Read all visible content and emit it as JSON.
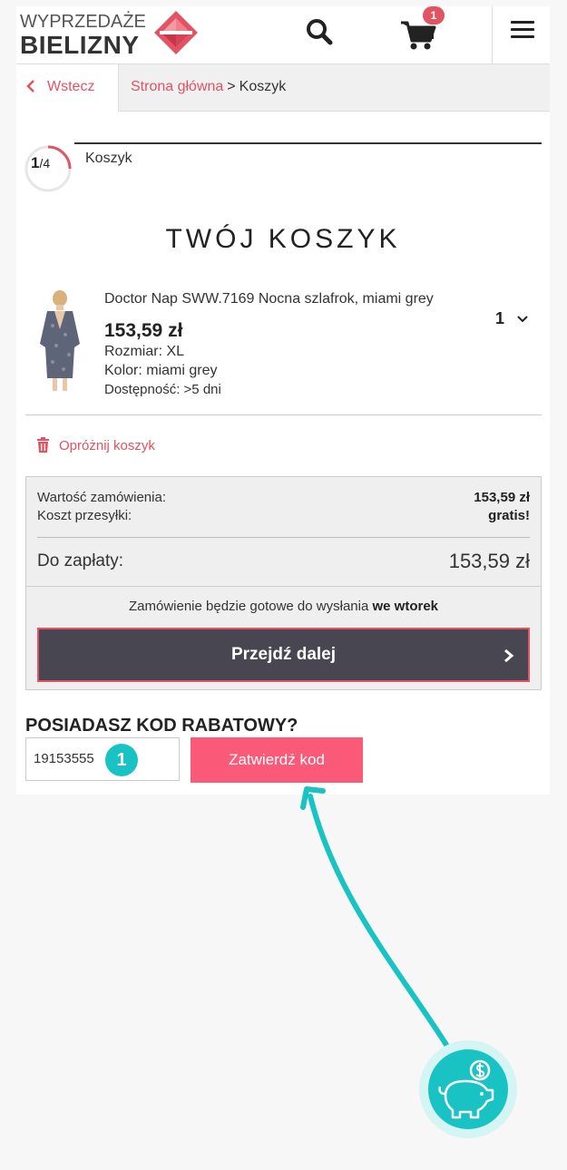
{
  "header": {
    "logo_line1": "WYPRZEDAŻE",
    "logo_line2": "BIELIZNY",
    "cart_count": "1",
    "icons": [
      "search-icon",
      "cart-icon",
      "hamburger-menu-icon"
    ]
  },
  "breadcrumb": {
    "back_label": "Wstecz",
    "home_label": "Strona główna",
    "separator": ">",
    "current_label": "Koszyk"
  },
  "steps": {
    "current": "1",
    "total": "/4",
    "label": "Koszyk"
  },
  "page_title": "TWÓJ KOSZYK",
  "product": {
    "name": "Doctor Nap SWW.7169 Nocna szlafrok, miami grey",
    "price": "153,59 zł",
    "size": "Rozmiar: XL",
    "color": "Kolor: miami grey",
    "availability": "Dostępność: >5 dni",
    "quantity": "1"
  },
  "empty_cart_label": "Opróżnij koszyk",
  "summary": {
    "order_value_label": "Wartość zamówienia:",
    "order_value": "153,59 zł",
    "shipping_label": "Koszt przesyłki:",
    "shipping_value": "gratis!",
    "to_pay_label": "Do zapłaty:",
    "to_pay_value": "153,59 zł",
    "ready_text": "Zamówienie będzie gotowe do wysłania",
    "ready_day": "we wtorek",
    "proceed_label": "Przejdź dalej"
  },
  "coupon": {
    "title": "POSIADASZ KOD RABATOWY?",
    "code_value": "19153555",
    "submit_label": "Zatwierdź kod"
  },
  "annotation": {
    "marker_label": "1"
  },
  "colors": {
    "accent": "#e25363",
    "submit_pink": "#fb5978",
    "dark_button": "#484751",
    "teal": "#19c3c3"
  }
}
